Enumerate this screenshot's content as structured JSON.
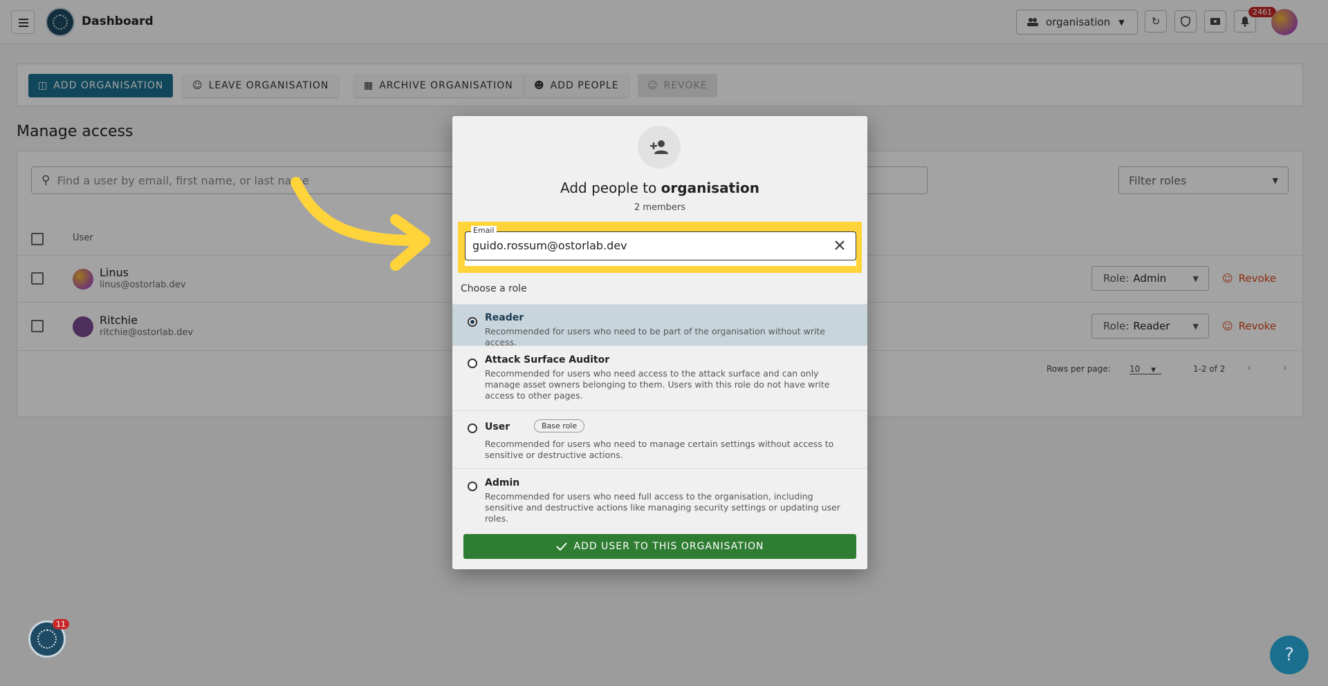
{
  "header": {
    "title": "Dashboard",
    "org_select": "organisation",
    "notification_count": "2461"
  },
  "toolbar": {
    "add_organisation": "ADD ORGANISATION",
    "leave_organisation": "LEAVE ORGANISATION",
    "archive_organisation": "ARCHIVE ORGANISATION",
    "add_people": "ADD PEOPLE",
    "revoke": "REVOKE"
  },
  "manage": {
    "title": "Manage access",
    "search_placeholder": "Find a user by email, first name, or last name",
    "filter_roles": "Filter roles",
    "col_user": "User",
    "users": [
      {
        "name": "Linus",
        "email": "linus@ostorlab.dev",
        "role_label": "Role:",
        "role": "Admin",
        "revoke": "Revoke"
      },
      {
        "name": "Ritchie",
        "email": "ritchie@ostorlab.dev",
        "role_label": "Role:",
        "role": "Reader",
        "revoke": "Revoke"
      }
    ],
    "rows_per_page_label": "Rows per page:",
    "rows_per_page": "10",
    "page_range": "1-2 of 2"
  },
  "modal": {
    "title_prefix": "Add people to",
    "title_org": "organisation",
    "members": "2 members",
    "email_label": "Email",
    "email_value": "guido.rossum@ostorlab.dev",
    "choose_role": "Choose a role",
    "roles": [
      {
        "name": "Reader",
        "desc": "Recommended for users who need to be part of the organisation without write access."
      },
      {
        "name": "Attack Surface Auditor",
        "desc": "Recommended for users who need access to the attack surface and can only manage asset owners belonging to them. Users with this role do not have write access to other pages."
      },
      {
        "name": "User",
        "chip": "Base role",
        "desc": "Recommended for users who need to manage certain settings without access to sensitive or destructive actions."
      },
      {
        "name": "Admin",
        "desc": "Recommended for users who need full access to the organisation, including sensitive and destructive actions like managing security settings or updating user roles."
      }
    ],
    "submit": "ADD USER TO THIS ORGANISATION"
  },
  "fab": {
    "badge": "11",
    "help": "?"
  },
  "colors": {
    "primary": "#1a6f8e",
    "success": "#2e7d32",
    "highlight": "#ffd43b",
    "danger": "#d84315"
  }
}
